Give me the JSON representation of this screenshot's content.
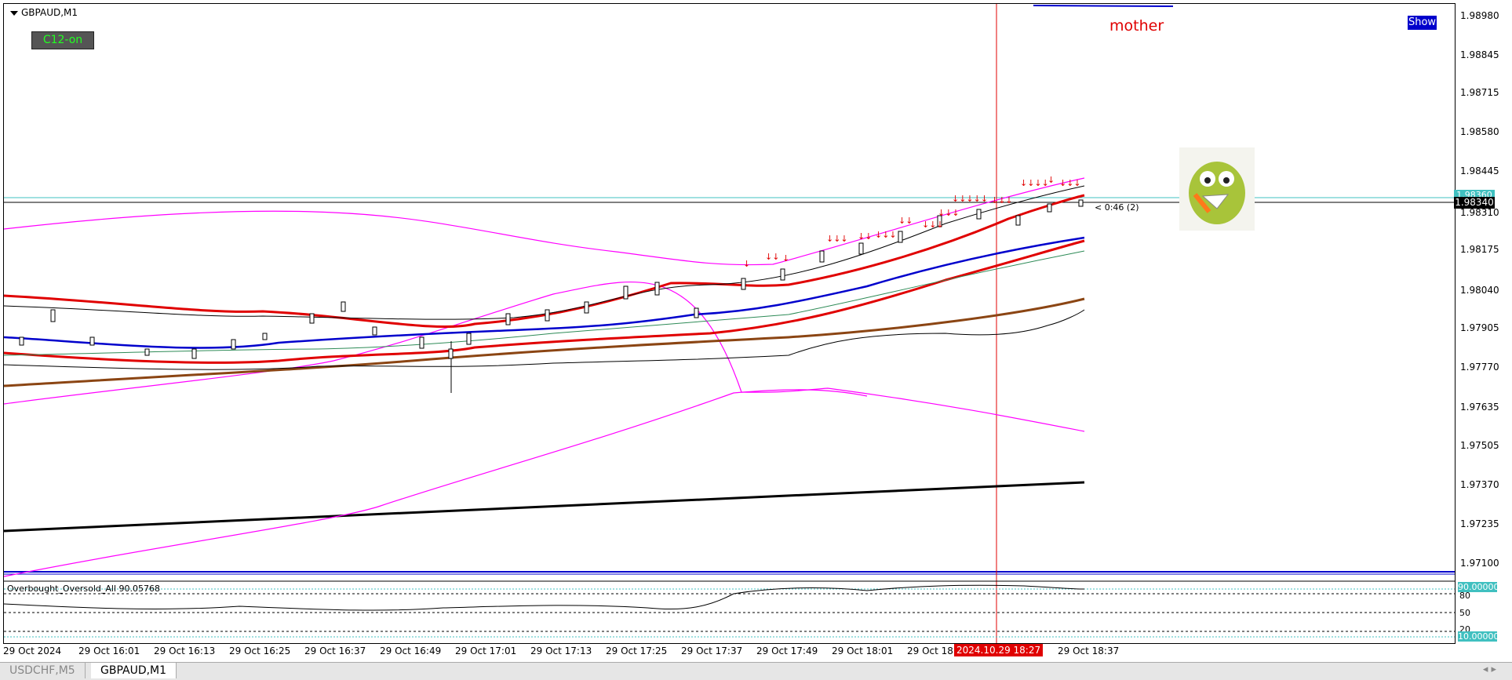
{
  "chart": {
    "symbol": "GBPAUD,M1",
    "c12_label": "C12-on",
    "mother_label": "mother",
    "show_label": "Show",
    "current_price": "1.98340",
    "current_price2": "1.98360",
    "timer_label": "< 0:46 (2)"
  },
  "price_axis": [
    "1.98980",
    "1.98845",
    "1.98715",
    "1.98580",
    "1.98445",
    "1.98310",
    "1.98175",
    "1.98040",
    "1.97905",
    "1.97770",
    "1.97635",
    "1.97505",
    "1.97370",
    "1.97235",
    "1.97100"
  ],
  "oscillator": {
    "label": "Overbought_Oversold_All 90.05768",
    "upper_value": "90.00000",
    "lower_value": "10.00000",
    "scale": [
      "80",
      "50",
      "20"
    ]
  },
  "time_axis": {
    "labels": [
      "29 Oct 2024",
      "29 Oct 16:01",
      "29 Oct 16:13",
      "29 Oct 16:25",
      "29 Oct 16:37",
      "29 Oct 16:49",
      "29 Oct 17:01",
      "29 Oct 17:13",
      "29 Oct 17:25",
      "29 Oct 17:37",
      "29 Oct 17:49",
      "29 Oct 18:01",
      "29 Oct 18:",
      "29 Oct 18:37"
    ],
    "highlight": "2024.10.29 18:27"
  },
  "tabs": [
    {
      "label": "USDCHF,M5",
      "active": false
    },
    {
      "label": "GBPAUD,M1",
      "active": true
    }
  ],
  "tab_nav": "◂ ▸",
  "colors": {
    "bollinger": "#ff00ff",
    "red_ma": "#e00000",
    "blue_ma": "#0000cc",
    "brown_ma": "#8b4513",
    "cursor_line": "#e00000",
    "osc_level": "#40c0c0"
  }
}
